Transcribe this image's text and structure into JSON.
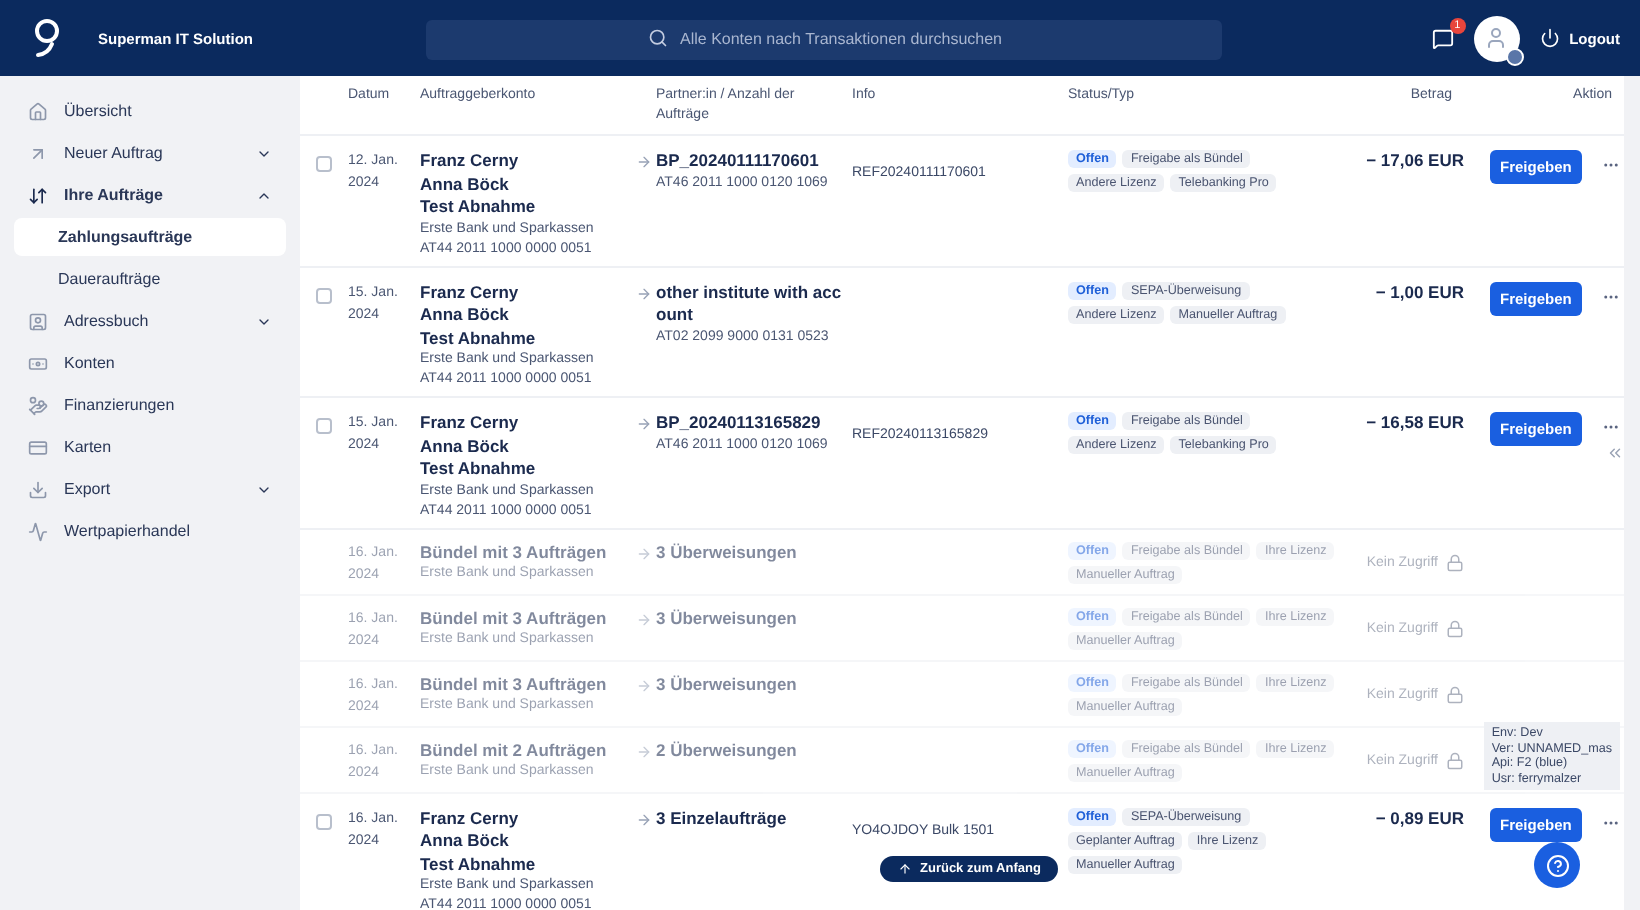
{
  "header": {
    "brand": "Superman IT Solution",
    "search": {
      "placeholder": "Alle Konten nach Transaktionen durchsuchen"
    },
    "notifications": "1",
    "logout": "Logout"
  },
  "sidebar": {
    "items": [
      {
        "label": "Übersicht",
        "selected": false
      },
      {
        "label": "Neuer Auftrag",
        "selected": false,
        "expanded": false
      },
      {
        "label": "Ihre Aufträge",
        "selected": false,
        "expanded": true,
        "children": [
          {
            "label": "Zahlungsaufträge",
            "selected": true
          },
          {
            "label": "Daueraufträge",
            "selected": false
          }
        ]
      },
      {
        "label": "Adressbuch",
        "selected": false,
        "expanded": false
      },
      {
        "label": "Konten",
        "selected": false
      },
      {
        "label": "Finanzierungen",
        "selected": false
      },
      {
        "label": "Karten",
        "selected": false
      },
      {
        "label": "Export",
        "selected": false,
        "expanded": false
      },
      {
        "label": "Wertpapierhandel",
        "selected": false
      }
    ]
  },
  "table": {
    "columns": [
      "Datum",
      "Auftraggeberkonto",
      "Partner:in / Anzahl der Aufträge",
      "Info",
      "Status/Typ",
      "Betrag",
      "Aktion"
    ],
    "rows": [
      {
        "kind": "single",
        "checked": false,
        "date": "12. Jan. 2024",
        "names": [
          "Franz Cerny",
          "Anna Böck",
          "Test Abnahme"
        ],
        "bank": "Erste Bank und Sparkassen",
        "iban": "AT44 2011 1000 0000 0051",
        "partner": "BP_20240111170601",
        "partner_iban": "AT46 2011 1000 0120 1069",
        "info": "REF20240111170601",
        "tags": [
          {
            "label": "Offen",
            "kind": "status"
          },
          {
            "label": "Freigabe als Bündel",
            "kind": "type"
          },
          {
            "label": "Andere Lizenz",
            "kind": "type"
          },
          {
            "label": "Telebanking Pro",
            "kind": "type"
          }
        ],
        "amount": "− 17,06 EUR",
        "action": "Freigeben"
      },
      {
        "kind": "single",
        "checked": false,
        "date": "15. Jan. 2024",
        "names": [
          "Franz Cerny",
          "Anna Böck",
          "Test Abnahme"
        ],
        "bank": "Erste Bank und Sparkassen",
        "iban": "AT44 2011 1000 0000 0051",
        "partner": "other institute with account",
        "partner_iban": "AT02 2099 9000 0131 0523",
        "tags": [
          {
            "label": "Offen",
            "kind": "status"
          },
          {
            "label": "SEPA-Überweisung",
            "kind": "type"
          },
          {
            "label": "Andere Lizenz",
            "kind": "type"
          },
          {
            "label": "Manueller Auftrag",
            "kind": "type"
          }
        ],
        "amount": "− 1,00 EUR",
        "action": "Freigeben"
      },
      {
        "kind": "single",
        "checked": false,
        "date": "15. Jan. 2024",
        "names": [
          "Franz Cerny",
          "Anna Böck",
          "Test Abnahme"
        ],
        "bank": "Erste Bank und Sparkassen",
        "iban": "AT44 2011 1000 0000 0051",
        "partner": "BP_20240113165829",
        "partner_iban": "AT46 2011 1000 0120 1069",
        "info": "REF20240113165829",
        "tags": [
          {
            "label": "Offen",
            "kind": "status"
          },
          {
            "label": "Freigabe als Bündel",
            "kind": "type"
          },
          {
            "label": "Andere Lizenz",
            "kind": "type"
          },
          {
            "label": "Telebanking Pro",
            "kind": "type"
          }
        ],
        "amount": "− 16,58 EUR",
        "action": "Freigeben"
      },
      {
        "kind": "bundle",
        "date": "16. Jan. 2024",
        "names": [
          "Bündel mit 3 Aufträgen"
        ],
        "bank": "Erste Bank und Sparkassen",
        "partner": "3 Überweisungen",
        "tags": [
          {
            "label": "Offen",
            "kind": "status"
          },
          {
            "label": "Freigabe als Bündel",
            "kind": "type"
          },
          {
            "label": "Ihre Lizenz",
            "kind": "type"
          },
          {
            "label": "Manueller Auftrag",
            "kind": "type"
          }
        ],
        "access": "Kein Zugriff"
      },
      {
        "kind": "bundle",
        "date": "16. Jan. 2024",
        "names": [
          "Bündel mit 3 Aufträgen"
        ],
        "bank": "Erste Bank und Sparkassen",
        "partner": "3 Überweisungen",
        "tags": [
          {
            "label": "Offen",
            "kind": "status"
          },
          {
            "label": "Freigabe als Bündel",
            "kind": "type"
          },
          {
            "label": "Ihre Lizenz",
            "kind": "type"
          },
          {
            "label": "Manueller Auftrag",
            "kind": "type"
          }
        ],
        "access": "Kein Zugriff"
      },
      {
        "kind": "bundle",
        "date": "16. Jan. 2024",
        "names": [
          "Bündel mit 3 Aufträgen"
        ],
        "bank": "Erste Bank und Sparkassen",
        "partner": "3 Überweisungen",
        "tags": [
          {
            "label": "Offen",
            "kind": "status"
          },
          {
            "label": "Freigabe als Bündel",
            "kind": "type"
          },
          {
            "label": "Ihre Lizenz",
            "kind": "type"
          },
          {
            "label": "Manueller Auftrag",
            "kind": "type"
          }
        ],
        "access": "Kein Zugriff"
      },
      {
        "kind": "bundle",
        "date": "16. Jan. 2024",
        "names": [
          "Bündel mit 2 Aufträgen"
        ],
        "bank": "Erste Bank und Sparkassen",
        "partner": "2 Überweisungen",
        "tags": [
          {
            "label": "Offen",
            "kind": "status"
          },
          {
            "label": "Freigabe als Bündel",
            "kind": "type"
          },
          {
            "label": "Ihre Lizenz",
            "kind": "type"
          },
          {
            "label": "Manueller Auftrag",
            "kind": "type"
          }
        ],
        "access": "Kein Zugriff"
      },
      {
        "kind": "single",
        "checked": false,
        "date": "16. Jan. 2024",
        "names": [
          "Franz Cerny",
          "Anna Böck",
          "Test Abnahme"
        ],
        "bank": "Erste Bank und Sparkassen",
        "iban": "AT44 2011 1000 0000 0051",
        "partner": "3 Einzelaufträge",
        "info": "YO4OJDOY Bulk 1501",
        "tags": [
          {
            "label": "Offen",
            "kind": "status"
          },
          {
            "label": "SEPA-Überweisung",
            "kind": "type"
          },
          {
            "label": "Geplanter Auftrag",
            "kind": "type"
          },
          {
            "label": "Ihre Lizenz",
            "kind": "type"
          },
          {
            "label": "Manueller Auftrag",
            "kind": "type"
          }
        ],
        "amount": "− 0,89 EUR",
        "action": "Freigeben"
      }
    ]
  },
  "back_to_top": "Zurück zum Anfang",
  "dev_info": [
    "Env: Dev",
    "Ver: UNNAMED_mas",
    "Api: F2 (blue)",
    "Usr: ferrymalzer"
  ]
}
